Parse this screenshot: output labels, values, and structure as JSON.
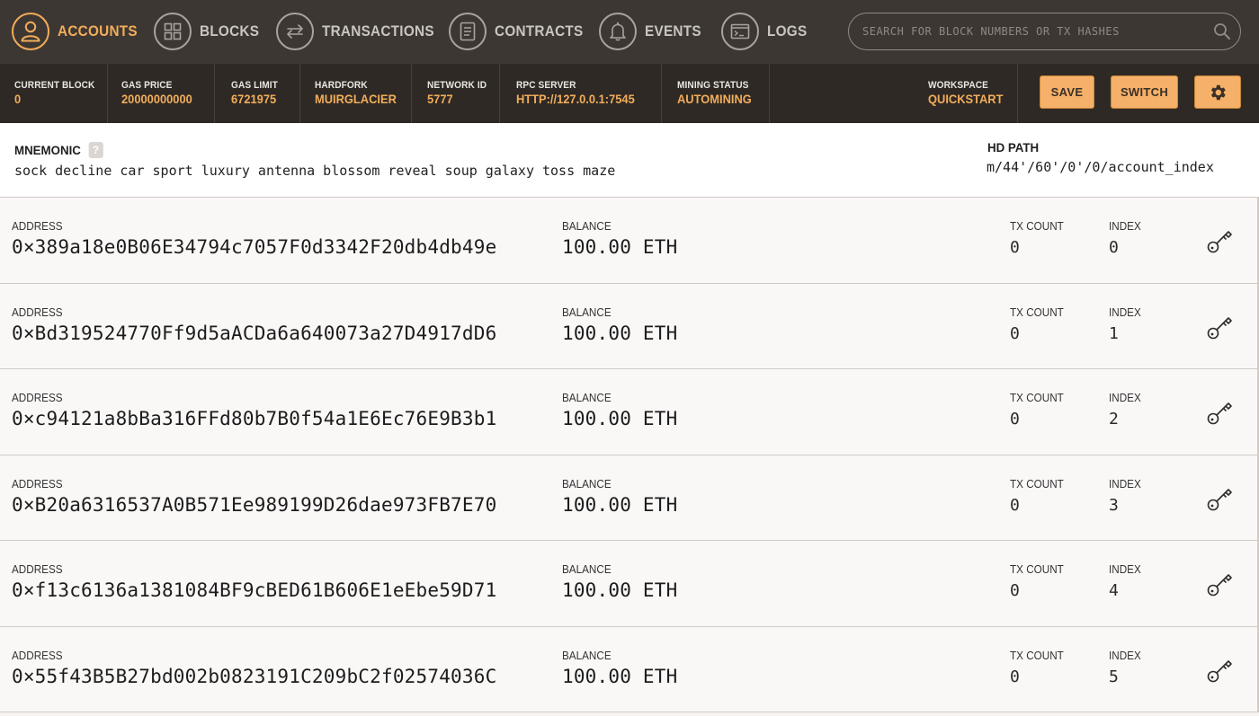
{
  "nav": {
    "items": [
      {
        "label": "ACCOUNTS",
        "icon": "user-icon",
        "active": true
      },
      {
        "label": "BLOCKS",
        "icon": "grid-icon",
        "active": false
      },
      {
        "label": "TRANSACTIONS",
        "icon": "arrows-icon",
        "active": false
      },
      {
        "label": "CONTRACTS",
        "icon": "document-icon",
        "active": false
      },
      {
        "label": "EVENTS",
        "icon": "bell-icon",
        "active": false
      },
      {
        "label": "LOGS",
        "icon": "terminal-icon",
        "active": false
      }
    ],
    "search_placeholder": "SEARCH FOR BLOCK NUMBERS OR TX HASHES"
  },
  "status": {
    "current_block": {
      "label": "CURRENT BLOCK",
      "value": "0"
    },
    "gas_price": {
      "label": "GAS PRICE",
      "value": "20000000000"
    },
    "gas_limit": {
      "label": "GAS LIMIT",
      "value": "6721975"
    },
    "hardfork": {
      "label": "HARDFORK",
      "value": "MUIRGLACIER"
    },
    "network_id": {
      "label": "NETWORK ID",
      "value": "5777"
    },
    "rpc_server": {
      "label": "RPC SERVER",
      "value": "HTTP://127.0.0.1:7545"
    },
    "mining_status": {
      "label": "MINING STATUS",
      "value": "AUTOMINING"
    },
    "workspace": {
      "label": "WORKSPACE",
      "value": "QUICKSTART"
    },
    "save_label": "SAVE",
    "switch_label": "SWITCH"
  },
  "mnemonic": {
    "title": "MNEMONIC",
    "help": "?",
    "words": "sock decline car sport luxury antenna blossom reveal soup galaxy toss maze",
    "hd_path_title": "HD PATH",
    "hd_path": "m/44'/60'/0'/0/account_index"
  },
  "account_labels": {
    "address": "ADDRESS",
    "balance": "BALANCE",
    "tx_count": "TX COUNT",
    "index": "INDEX"
  },
  "accounts": [
    {
      "address": "0×389a18e0B06E34794c7057F0d3342F20db4db49e",
      "balance": "100.00 ETH",
      "tx_count": "0",
      "index": "0"
    },
    {
      "address": "0×Bd319524770Ff9d5aACDa6a640073a27D4917dD6",
      "balance": "100.00 ETH",
      "tx_count": "0",
      "index": "1"
    },
    {
      "address": "0×c94121a8bBa316FFd80b7B0f54a1E6Ec76E9B3b1",
      "balance": "100.00 ETH",
      "tx_count": "0",
      "index": "2"
    },
    {
      "address": "0×B20a6316537A0B571Ee989199D26dae973FB7E70",
      "balance": "100.00 ETH",
      "tx_count": "0",
      "index": "3"
    },
    {
      "address": "0×f13c6136a1381084BF9cBED61B606E1eEbe59D71",
      "balance": "100.00 ETH",
      "tx_count": "0",
      "index": "4"
    },
    {
      "address": "0×55f43B5B27bd002b0823191C209bC2f02574036C",
      "balance": "100.00 ETH",
      "tx_count": "0",
      "index": "5"
    }
  ],
  "colors": {
    "accent": "#f2ad5a",
    "nav_bg": "#3d3733",
    "status_bg": "#2e2925",
    "button_bg": "#f5b069"
  }
}
